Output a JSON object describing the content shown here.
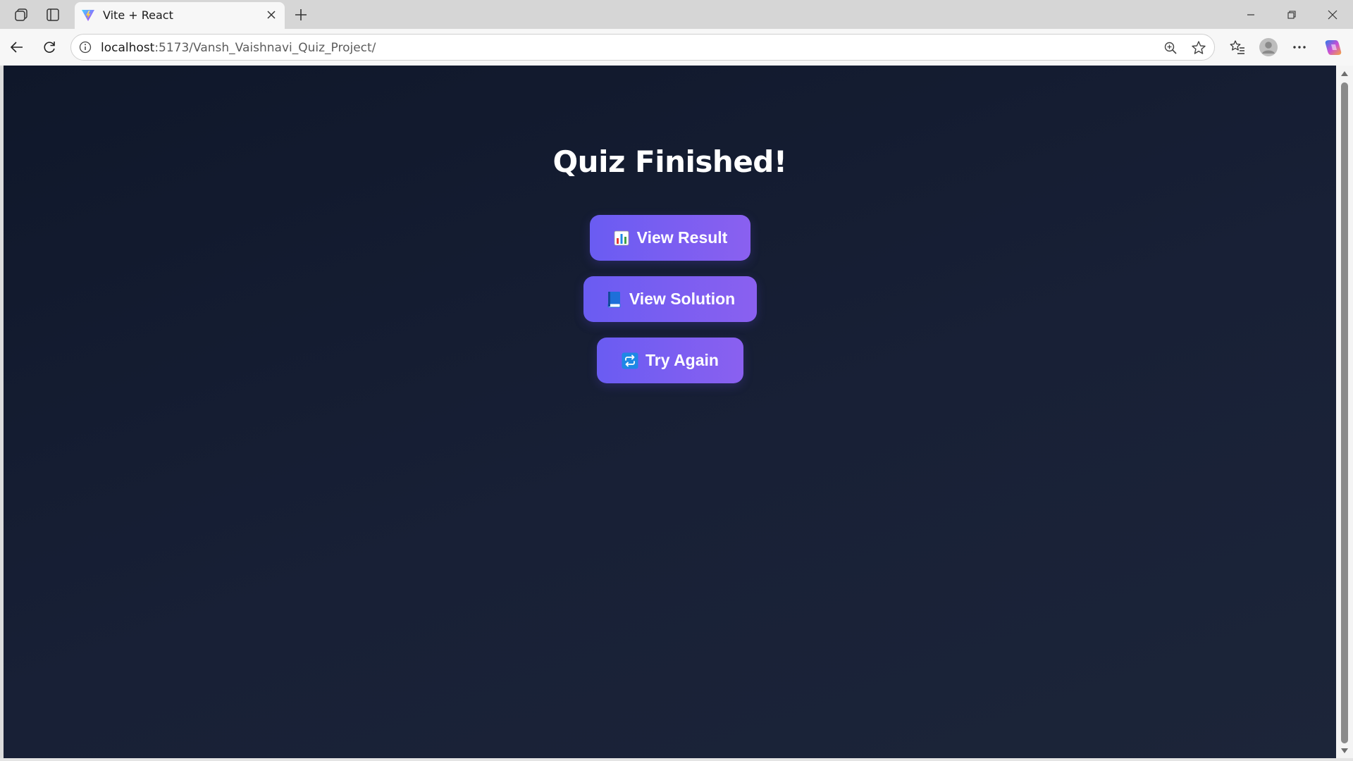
{
  "browser": {
    "tab_title": "Vite + React",
    "url_host": "localhost",
    "url_path": ":5173/Vansh_Vaishnavi_Quiz_Project/",
    "icons": {
      "workspaces": "workspaces-icon",
      "tab_actions": "tab-actions-icon",
      "favicon": "vite-logo-icon",
      "close_tab": "close-icon",
      "new_tab": "plus-icon",
      "minimize": "minimize-icon",
      "restore": "restore-icon",
      "close_window": "close-icon",
      "back": "back-arrow-icon",
      "refresh": "refresh-icon",
      "site_info": "info-icon",
      "zoom": "zoom-icon",
      "favorite": "star-icon",
      "favorites": "favorites-icon",
      "profile": "profile-icon",
      "more": "more-icon",
      "copilot": "copilot-icon"
    }
  },
  "page": {
    "title": "Quiz Finished!",
    "buttons": [
      {
        "label": "View Result",
        "icon": "bar-chart-icon"
      },
      {
        "label": "View Solution",
        "icon": "book-icon"
      },
      {
        "label": "Try Again",
        "icon": "repeat-icon"
      }
    ],
    "background_colors": [
      "#0f172a",
      "#1c2539"
    ],
    "button_colors": [
      "#6a5cf2",
      "#8a60f0"
    ]
  }
}
